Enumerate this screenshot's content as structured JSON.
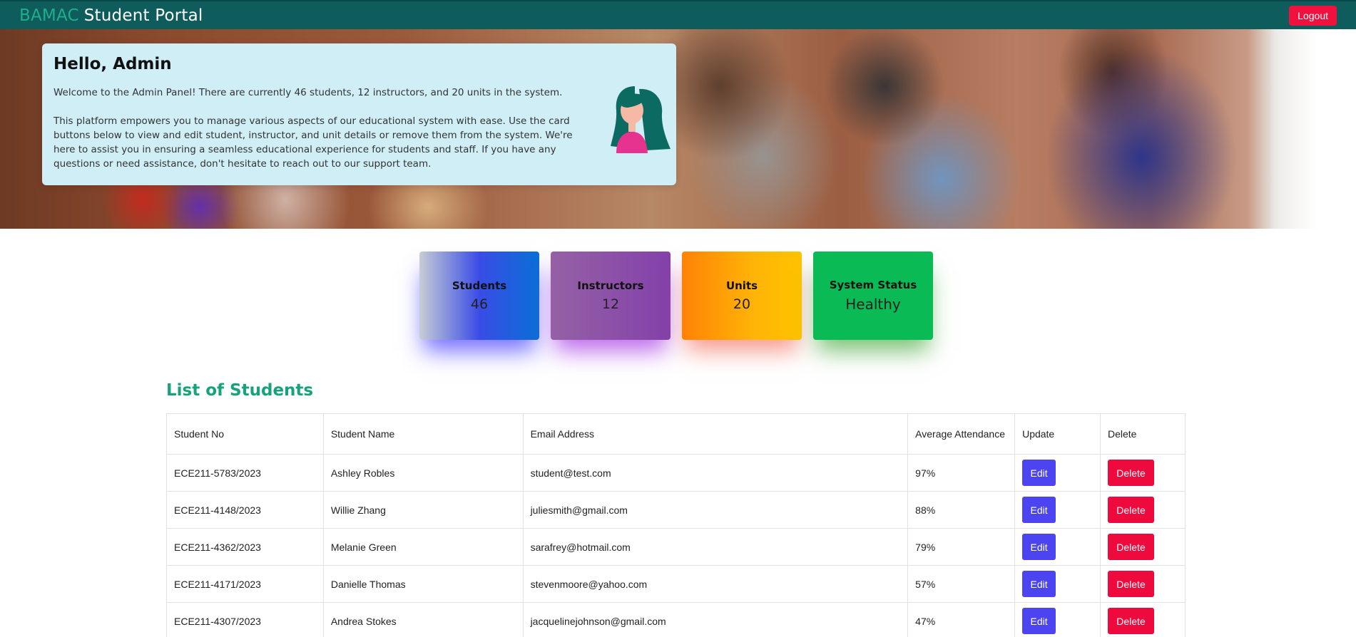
{
  "navbar": {
    "brand_accent": "BAMAC",
    "brand_main": "Student Portal",
    "logout_label": "Logout"
  },
  "welcome": {
    "title": "Hello, Admin",
    "paragraph1": "Welcome to the Admin Panel! There are currently 46 students, 12 instructors, and 20 units in the system.",
    "paragraph2": "This platform empowers you to manage various aspects of our educational system with ease. Use the card buttons below to view and edit student, instructor, and unit details or remove them from the system. We're here to assist you in ensuring a seamless educational experience for students and staff. If you have any questions or need assistance, don't hesitate to reach out to our support team."
  },
  "stats": [
    {
      "label": "Students",
      "value": "46"
    },
    {
      "label": "Instructors",
      "value": "12"
    },
    {
      "label": "Units",
      "value": "20"
    },
    {
      "label": "System Status",
      "value": "Healthy"
    }
  ],
  "students_list": {
    "title": "List of Students",
    "columns": [
      "Student No",
      "Student Name",
      "Email Address",
      "Average Attendance",
      "Update",
      "Delete"
    ],
    "edit_label": "Edit",
    "delete_label": "Delete",
    "rows": [
      {
        "student_no": "ECE211-5783/2023",
        "name": "Ashley Robles",
        "email": "student@test.com",
        "attendance": "97%"
      },
      {
        "student_no": "ECE211-4148/2023",
        "name": "Willie Zhang",
        "email": "juliesmith@gmail.com",
        "attendance": "88%"
      },
      {
        "student_no": "ECE211-4362/2023",
        "name": "Melanie Green",
        "email": "sarafrey@hotmail.com",
        "attendance": "79%"
      },
      {
        "student_no": "ECE211-4171/2023",
        "name": "Danielle Thomas",
        "email": "stevenmoore@yahoo.com",
        "attendance": "57%"
      },
      {
        "student_no": "ECE211-4307/2023",
        "name": "Andrea Stokes",
        "email": "jacquelinejohnson@gmail.com",
        "attendance": "47%"
      }
    ]
  },
  "colors": {
    "navbar": "#0e5c5c",
    "brand_accent": "#1fae8c",
    "logout": "#f0113f",
    "welcome_card": "#cfeef6",
    "list_title": "#16a37b",
    "edit_button": "#4c44f0",
    "delete_button": "#ef0a3d",
    "status_card": "#0aba55"
  },
  "icons": {
    "avatar": "admin-avatar-icon"
  }
}
